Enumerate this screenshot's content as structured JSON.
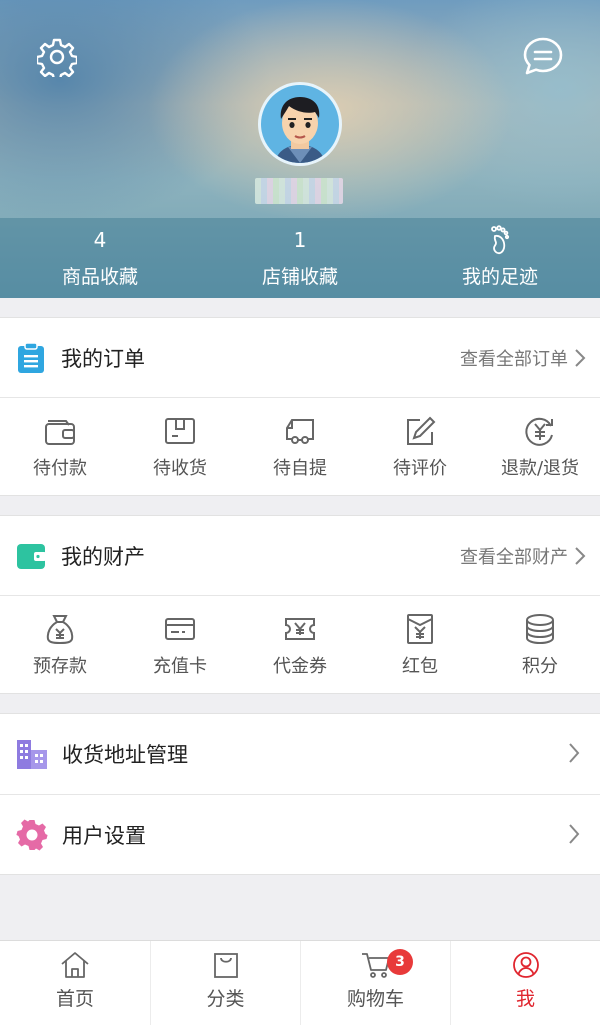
{
  "profile": {
    "favorites_goods": {
      "count": "4",
      "label": "商品收藏"
    },
    "favorites_shops": {
      "count": "1",
      "label": "店铺收藏"
    },
    "footprints": {
      "label": "我的足迹",
      "icon": "footprint-icon"
    }
  },
  "orders": {
    "title": "我的订单",
    "view_all": "查看全部订单",
    "items": [
      {
        "label": "待付款",
        "icon": "wallet-icon"
      },
      {
        "label": "待收货",
        "icon": "package-icon"
      },
      {
        "label": "待自提",
        "icon": "truck-icon"
      },
      {
        "label": "待评价",
        "icon": "edit-icon"
      },
      {
        "label": "退款/退货",
        "icon": "refund-icon"
      }
    ]
  },
  "assets": {
    "title": "我的财产",
    "view_all": "查看全部财产",
    "items": [
      {
        "label": "预存款",
        "icon": "money-bag-icon"
      },
      {
        "label": "充值卡",
        "icon": "card-icon"
      },
      {
        "label": "代金券",
        "icon": "coupon-icon"
      },
      {
        "label": "红包",
        "icon": "red-envelope-icon"
      },
      {
        "label": "积分",
        "icon": "coins-icon"
      }
    ]
  },
  "links": [
    {
      "label": "收货地址管理",
      "icon": "building-icon"
    },
    {
      "label": "用户设置",
      "icon": "gear-icon"
    }
  ],
  "tabbar": {
    "tabs": [
      {
        "label": "首页",
        "icon": "home-icon"
      },
      {
        "label": "分类",
        "icon": "bag-icon"
      },
      {
        "label": "购物车",
        "icon": "cart-icon",
        "badge": "3"
      },
      {
        "label": "我",
        "icon": "user-icon",
        "active": true
      }
    ]
  },
  "colors": {
    "accent_red": "#e0262f",
    "badge_red": "#e83a3a",
    "orders_icon": "#2fa6e0",
    "assets_icon": "#2dc3a0",
    "address_icon": "#8e7be0",
    "settings_icon": "#e56aa6"
  }
}
